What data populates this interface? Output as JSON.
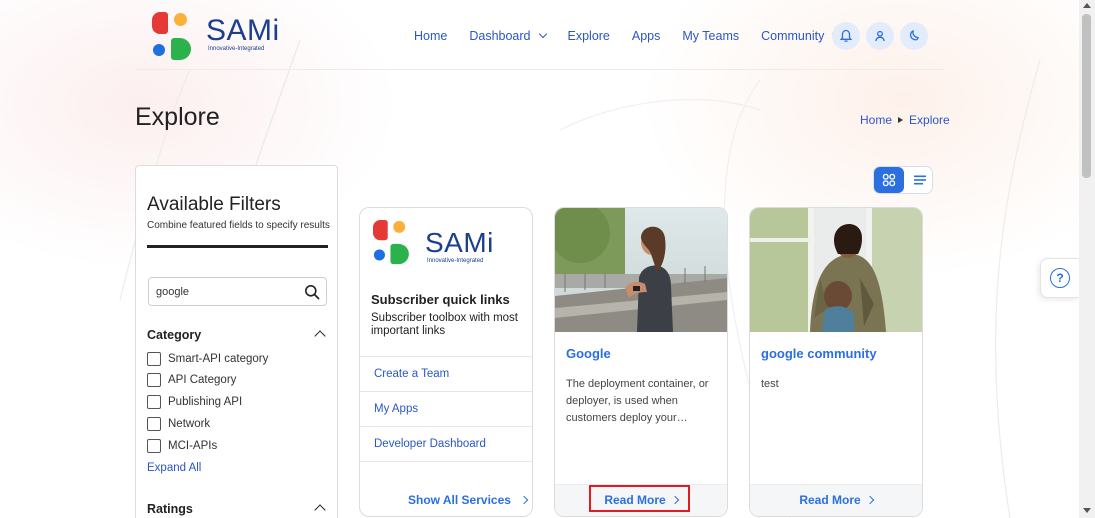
{
  "brand": {
    "name": "SAMi",
    "tagline": "Innovative-Integrated"
  },
  "nav": {
    "items": [
      {
        "label": "Home",
        "dropdown": false
      },
      {
        "label": "Dashboard",
        "dropdown": true
      },
      {
        "label": "Explore",
        "dropdown": false
      },
      {
        "label": "Apps",
        "dropdown": false
      },
      {
        "label": "My Teams",
        "dropdown": false
      },
      {
        "label": "Community",
        "dropdown": true
      }
    ],
    "icons": [
      "bell-icon",
      "user-icon",
      "moon-icon"
    ]
  },
  "page": {
    "title": "Explore"
  },
  "breadcrumb": {
    "home": "Home",
    "current": "Explore"
  },
  "filters": {
    "title": "Available Filters",
    "subtitle": "Combine featured fields to specify results",
    "search_value": "google",
    "category_title": "Category",
    "categories": [
      "Smart-API category",
      "API Category",
      "Publishing API",
      "Network",
      "MCI-APIs"
    ],
    "expand_label": "Expand All",
    "ratings_title": "Ratings"
  },
  "quick_links": {
    "title": "Subscriber quick links",
    "subtitle": "Subscriber toolbox with most important links",
    "links": [
      "Create a Team",
      "My Apps",
      "Developer Dashboard"
    ],
    "show_all": "Show All Services"
  },
  "cards": [
    {
      "title": "Google",
      "description": "The deployment container, or deployer, is used when customers deploy your…",
      "read_more": "Read More"
    },
    {
      "title": "google community",
      "description": "test",
      "read_more": "Read More"
    }
  ],
  "colors": {
    "accent": "#2b6fe0",
    "brand_text": "#1a3f8f",
    "highlight": "#e01b24"
  },
  "help_icon": "?"
}
